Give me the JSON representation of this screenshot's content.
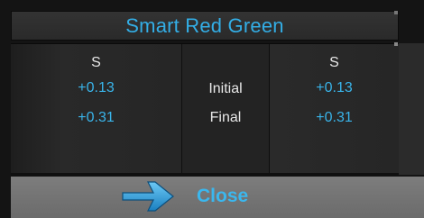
{
  "window": {
    "title": "Smart Red Green"
  },
  "table": {
    "left": {
      "header": "S",
      "values": [
        "+0.13",
        "+0.31"
      ]
    },
    "middle": {
      "labels": [
        "Initial",
        "Final"
      ]
    },
    "right": {
      "header": "S",
      "values": [
        "+0.13",
        "+0.31"
      ]
    }
  },
  "footer": {
    "close_label": "Close",
    "close_icon": "arrow-right-icon"
  },
  "colors": {
    "accent": "#39b4ea",
    "text": "#e8e8e8",
    "panel": "#222222",
    "footer": "#777777"
  }
}
